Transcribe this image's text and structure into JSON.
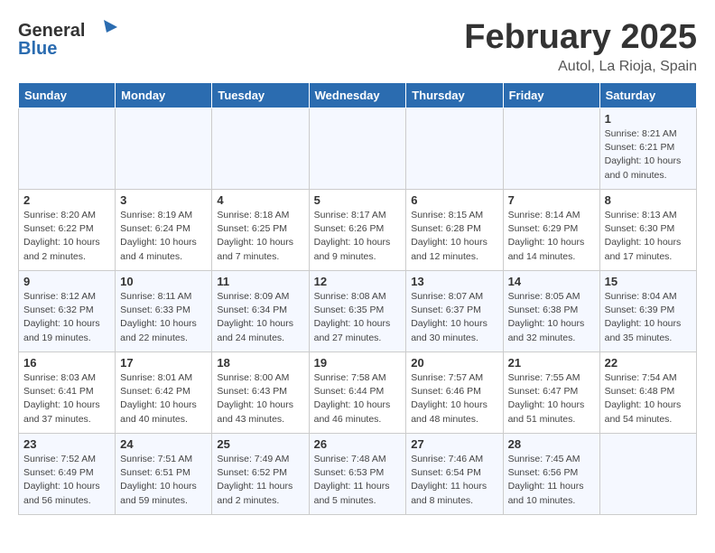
{
  "header": {
    "logo_general": "General",
    "logo_blue": "Blue",
    "month_year": "February 2025",
    "location": "Autol, La Rioja, Spain"
  },
  "weekdays": [
    "Sunday",
    "Monday",
    "Tuesday",
    "Wednesday",
    "Thursday",
    "Friday",
    "Saturday"
  ],
  "weeks": [
    [
      {
        "day": "",
        "info": ""
      },
      {
        "day": "",
        "info": ""
      },
      {
        "day": "",
        "info": ""
      },
      {
        "day": "",
        "info": ""
      },
      {
        "day": "",
        "info": ""
      },
      {
        "day": "",
        "info": ""
      },
      {
        "day": "1",
        "info": "Sunrise: 8:21 AM\nSunset: 6:21 PM\nDaylight: 10 hours and 0 minutes."
      }
    ],
    [
      {
        "day": "2",
        "info": "Sunrise: 8:20 AM\nSunset: 6:22 PM\nDaylight: 10 hours and 2 minutes."
      },
      {
        "day": "3",
        "info": "Sunrise: 8:19 AM\nSunset: 6:24 PM\nDaylight: 10 hours and 4 minutes."
      },
      {
        "day": "4",
        "info": "Sunrise: 8:18 AM\nSunset: 6:25 PM\nDaylight: 10 hours and 7 minutes."
      },
      {
        "day": "5",
        "info": "Sunrise: 8:17 AM\nSunset: 6:26 PM\nDaylight: 10 hours and 9 minutes."
      },
      {
        "day": "6",
        "info": "Sunrise: 8:15 AM\nSunset: 6:28 PM\nDaylight: 10 hours and 12 minutes."
      },
      {
        "day": "7",
        "info": "Sunrise: 8:14 AM\nSunset: 6:29 PM\nDaylight: 10 hours and 14 minutes."
      },
      {
        "day": "8",
        "info": "Sunrise: 8:13 AM\nSunset: 6:30 PM\nDaylight: 10 hours and 17 minutes."
      }
    ],
    [
      {
        "day": "9",
        "info": "Sunrise: 8:12 AM\nSunset: 6:32 PM\nDaylight: 10 hours and 19 minutes."
      },
      {
        "day": "10",
        "info": "Sunrise: 8:11 AM\nSunset: 6:33 PM\nDaylight: 10 hours and 22 minutes."
      },
      {
        "day": "11",
        "info": "Sunrise: 8:09 AM\nSunset: 6:34 PM\nDaylight: 10 hours and 24 minutes."
      },
      {
        "day": "12",
        "info": "Sunrise: 8:08 AM\nSunset: 6:35 PM\nDaylight: 10 hours and 27 minutes."
      },
      {
        "day": "13",
        "info": "Sunrise: 8:07 AM\nSunset: 6:37 PM\nDaylight: 10 hours and 30 minutes."
      },
      {
        "day": "14",
        "info": "Sunrise: 8:05 AM\nSunset: 6:38 PM\nDaylight: 10 hours and 32 minutes."
      },
      {
        "day": "15",
        "info": "Sunrise: 8:04 AM\nSunset: 6:39 PM\nDaylight: 10 hours and 35 minutes."
      }
    ],
    [
      {
        "day": "16",
        "info": "Sunrise: 8:03 AM\nSunset: 6:41 PM\nDaylight: 10 hours and 37 minutes."
      },
      {
        "day": "17",
        "info": "Sunrise: 8:01 AM\nSunset: 6:42 PM\nDaylight: 10 hours and 40 minutes."
      },
      {
        "day": "18",
        "info": "Sunrise: 8:00 AM\nSunset: 6:43 PM\nDaylight: 10 hours and 43 minutes."
      },
      {
        "day": "19",
        "info": "Sunrise: 7:58 AM\nSunset: 6:44 PM\nDaylight: 10 hours and 46 minutes."
      },
      {
        "day": "20",
        "info": "Sunrise: 7:57 AM\nSunset: 6:46 PM\nDaylight: 10 hours and 48 minutes."
      },
      {
        "day": "21",
        "info": "Sunrise: 7:55 AM\nSunset: 6:47 PM\nDaylight: 10 hours and 51 minutes."
      },
      {
        "day": "22",
        "info": "Sunrise: 7:54 AM\nSunset: 6:48 PM\nDaylight: 10 hours and 54 minutes."
      }
    ],
    [
      {
        "day": "23",
        "info": "Sunrise: 7:52 AM\nSunset: 6:49 PM\nDaylight: 10 hours and 56 minutes."
      },
      {
        "day": "24",
        "info": "Sunrise: 7:51 AM\nSunset: 6:51 PM\nDaylight: 10 hours and 59 minutes."
      },
      {
        "day": "25",
        "info": "Sunrise: 7:49 AM\nSunset: 6:52 PM\nDaylight: 11 hours and 2 minutes."
      },
      {
        "day": "26",
        "info": "Sunrise: 7:48 AM\nSunset: 6:53 PM\nDaylight: 11 hours and 5 minutes."
      },
      {
        "day": "27",
        "info": "Sunrise: 7:46 AM\nSunset: 6:54 PM\nDaylight: 11 hours and 8 minutes."
      },
      {
        "day": "28",
        "info": "Sunrise: 7:45 AM\nSunset: 6:56 PM\nDaylight: 11 hours and 10 minutes."
      },
      {
        "day": "",
        "info": ""
      }
    ]
  ]
}
